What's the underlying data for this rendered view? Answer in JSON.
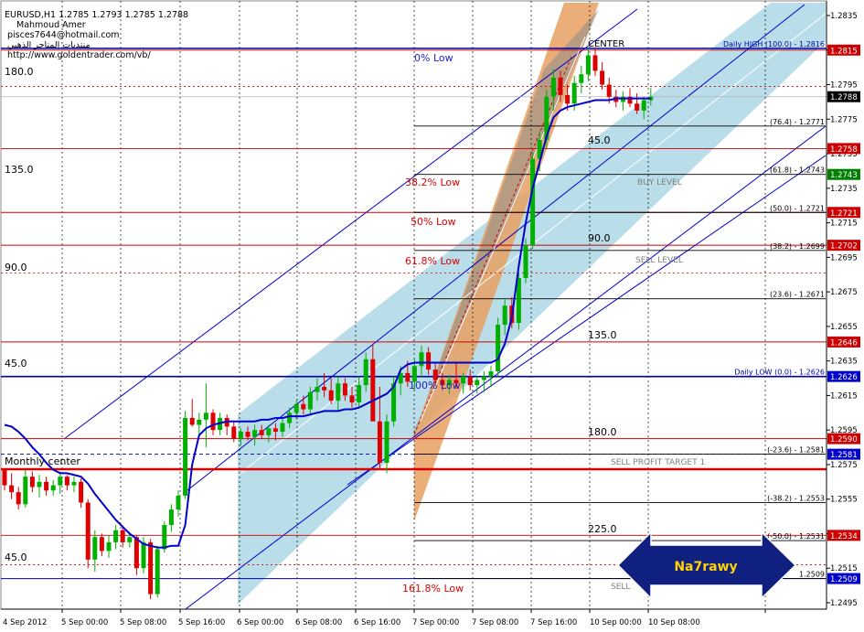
{
  "chart_data": {
    "type": "candlestick",
    "header": {
      "symbol_line": "EURUSD,H1  1.2785 1.2793 1.2785 1.2788",
      "author": "Mahmoud Amer",
      "email": "pisces7644@hotmail.com",
      "arabic": "منتديات المتاجر الذهبي",
      "url": "http://www.goldentrader.com/vb/"
    },
    "x_ticks": [
      "4 Sep 2012",
      "5 Sep 00:00",
      "5 Sep 08:00",
      "5 Sep 16:00",
      "6 Sep 00:00",
      "6 Sep 08:00",
      "6 Sep 16:00",
      "7 Sep 00:00",
      "7 Sep 08:00",
      "7 Sep 16:00",
      "10 Sep 00:00",
      "10 Sep 08:00"
    ],
    "y_ticks": [
      1.2835,
      1.2815,
      1.2795,
      1.2775,
      1.2755,
      1.2735,
      1.2715,
      1.2695,
      1.2675,
      1.2655,
      1.2635,
      1.2615,
      1.2595,
      1.2575,
      1.2555,
      1.2535,
      1.2515,
      1.2495
    ],
    "ylim": [
      1.249,
      1.284
    ],
    "candles": [
      [
        1.2572,
        1.2573,
        1.256,
        1.2563
      ],
      [
        1.2563,
        1.257,
        1.2555,
        1.2559
      ],
      [
        1.2559,
        1.2562,
        1.2549,
        1.2552
      ],
      [
        1.2552,
        1.2572,
        1.255,
        1.2568
      ],
      [
        1.2568,
        1.2571,
        1.2559,
        1.2562
      ],
      [
        1.2562,
        1.2569,
        1.2556,
        1.2565
      ],
      [
        1.2565,
        1.2568,
        1.2557,
        1.256
      ],
      [
        1.256,
        1.2566,
        1.2557,
        1.2563
      ],
      [
        1.2563,
        1.2571,
        1.2558,
        1.2568
      ],
      [
        1.2568,
        1.2569,
        1.256,
        1.2563
      ],
      [
        1.2563,
        1.2568,
        1.2559,
        1.2565
      ],
      [
        1.2565,
        1.2567,
        1.255,
        1.2553
      ],
      [
        1.2553,
        1.2555,
        1.2515,
        1.252
      ],
      [
        1.252,
        1.2537,
        1.2513,
        1.2533
      ],
      [
        1.2533,
        1.2535,
        1.2522,
        1.2525
      ],
      [
        1.2525,
        1.2534,
        1.2521,
        1.253
      ],
      [
        1.253,
        1.254,
        1.2526,
        1.2537
      ],
      [
        1.2537,
        1.2539,
        1.2527,
        1.253
      ],
      [
        1.253,
        1.2536,
        1.2527,
        1.2533
      ],
      [
        1.2533,
        1.2534,
        1.2511,
        1.2515
      ],
      [
        1.2515,
        1.2533,
        1.2512,
        1.253
      ],
      [
        1.253,
        1.2532,
        1.2497,
        1.25
      ],
      [
        1.25,
        1.2528,
        1.2498,
        1.2526
      ],
      [
        1.2526,
        1.2542,
        1.2524,
        1.254
      ],
      [
        1.254,
        1.2552,
        1.2536,
        1.2549
      ],
      [
        1.2549,
        1.256,
        1.2545,
        1.2557
      ],
      [
        1.2557,
        1.2606,
        1.2555,
        1.2602
      ],
      [
        1.2602,
        1.2613,
        1.2597,
        1.2598
      ],
      [
        1.2598,
        1.2605,
        1.2592,
        1.2601
      ],
      [
        1.2601,
        1.2622,
        1.2585,
        1.2605
      ],
      [
        1.2605,
        1.2607,
        1.2592,
        1.2595
      ],
      [
        1.2595,
        1.2605,
        1.2592,
        1.2602
      ],
      [
        1.2602,
        1.2604,
        1.2592,
        1.2597
      ],
      [
        1.2597,
        1.26,
        1.2588,
        1.259
      ],
      [
        1.259,
        1.2596,
        1.2586,
        1.2594
      ],
      [
        1.2594,
        1.2597,
        1.2589,
        1.2591
      ],
      [
        1.2591,
        1.2598,
        1.2586,
        1.2595
      ],
      [
        1.2595,
        1.2598,
        1.259,
        1.2592
      ],
      [
        1.2592,
        1.2598,
        1.2588,
        1.2596
      ],
      [
        1.2596,
        1.2599,
        1.2589,
        1.2594
      ],
      [
        1.2594,
        1.2602,
        1.2591,
        1.2599
      ],
      [
        1.2599,
        1.2608,
        1.2596,
        1.2605
      ],
      [
        1.2605,
        1.2612,
        1.2601,
        1.261
      ],
      [
        1.261,
        1.2615,
        1.2604,
        1.2607
      ],
      [
        1.2607,
        1.262,
        1.2604,
        1.2617
      ],
      [
        1.2617,
        1.2625,
        1.2612,
        1.262
      ],
      [
        1.262,
        1.2628,
        1.2614,
        1.2618
      ],
      [
        1.2618,
        1.2625,
        1.261,
        1.2612
      ],
      [
        1.2612,
        1.2626,
        1.2606,
        1.2622
      ],
      [
        1.2622,
        1.2625,
        1.2612,
        1.2615
      ],
      [
        1.2615,
        1.262,
        1.2608,
        1.2611
      ],
      [
        1.2611,
        1.2626,
        1.2608,
        1.2621
      ],
      [
        1.2621,
        1.264,
        1.2617,
        1.2636
      ],
      [
        1.2636,
        1.2645,
        1.263,
        1.26
      ],
      [
        1.26,
        1.262,
        1.2573,
        1.2576
      ],
      [
        1.2576,
        1.2604,
        1.257,
        1.26
      ],
      [
        1.26,
        1.2626,
        1.2597,
        1.2622
      ],
      [
        1.2622,
        1.2632,
        1.2615,
        1.2628
      ],
      [
        1.2628,
        1.2635,
        1.262,
        1.2623
      ],
      [
        1.2623,
        1.2636,
        1.2618,
        1.2632
      ],
      [
        1.2632,
        1.2644,
        1.2626,
        1.264
      ],
      [
        1.264,
        1.2643,
        1.2627,
        1.263
      ],
      [
        1.263,
        1.2634,
        1.2621,
        1.2624
      ],
      [
        1.2624,
        1.2628,
        1.2618,
        1.2621
      ],
      [
        1.2621,
        1.2627,
        1.2616,
        1.2624
      ],
      [
        1.2624,
        1.2634,
        1.2619,
        1.2622
      ],
      [
        1.2622,
        1.2628,
        1.2616,
        1.2626
      ],
      [
        1.2626,
        1.263,
        1.2618,
        1.2621
      ],
      [
        1.2621,
        1.2626,
        1.2616,
        1.2624
      ],
      [
        1.2624,
        1.2629,
        1.2617,
        1.2626
      ],
      [
        1.2626,
        1.2632,
        1.262,
        1.2629
      ],
      [
        1.2629,
        1.266,
        1.2626,
        1.2656
      ],
      [
        1.2656,
        1.2671,
        1.265,
        1.2667
      ],
      [
        1.2667,
        1.2672,
        1.2654,
        1.2657
      ],
      [
        1.2657,
        1.2686,
        1.2653,
        1.2683
      ],
      [
        1.2683,
        1.2706,
        1.268,
        1.2702
      ],
      [
        1.2702,
        1.2756,
        1.27,
        1.2752
      ],
      [
        1.2752,
        1.2768,
        1.2745,
        1.2763
      ],
      [
        1.2763,
        1.2792,
        1.2758,
        1.2788
      ],
      [
        1.2788,
        1.2804,
        1.278,
        1.2799
      ],
      [
        1.2799,
        1.2803,
        1.2785,
        1.2789
      ],
      [
        1.2789,
        1.2795,
        1.278,
        1.2784
      ],
      [
        1.2784,
        1.28,
        1.278,
        1.2796
      ],
      [
        1.2796,
        1.2806,
        1.279,
        1.2801
      ],
      [
        1.2801,
        1.2816,
        1.2797,
        1.2812
      ],
      [
        1.2812,
        1.2816,
        1.28,
        1.2803
      ],
      [
        1.2803,
        1.2808,
        1.2792,
        1.2795
      ],
      [
        1.2795,
        1.2799,
        1.2784,
        1.2788
      ],
      [
        1.2788,
        1.2792,
        1.2782,
        1.2785
      ],
      [
        1.2785,
        1.2791,
        1.278,
        1.2788
      ],
      [
        1.2788,
        1.2793,
        1.2782,
        1.2784
      ],
      [
        1.2784,
        1.279,
        1.2778,
        1.278
      ],
      [
        1.278,
        1.2788,
        1.2775,
        1.2786
      ],
      [
        1.2786,
        1.2793,
        1.2783,
        1.2788
      ]
    ],
    "ma_line": [
      1.2598,
      1.2597,
      1.2594,
      1.259,
      1.2585,
      1.2581,
      1.2576,
      1.2572,
      1.257,
      1.257,
      1.2569,
      1.2568,
      1.2564,
      1.2558,
      1.2553,
      1.2548,
      1.2543,
      1.2539,
      1.2535,
      1.2532,
      1.2529,
      1.2528,
      1.2527,
      1.2527,
      1.2528,
      1.2528,
      1.254,
      1.2575,
      1.2592,
      1.2596,
      1.2598,
      1.2599,
      1.26,
      1.26,
      1.26,
      1.26,
      1.26,
      1.2601,
      1.2601,
      1.2602,
      1.2602,
      1.2603,
      1.2603,
      1.2603,
      1.2604,
      1.2605,
      1.2606,
      1.2606,
      1.2606,
      1.2607,
      1.2607,
      1.2608,
      1.261,
      1.2612,
      1.2614,
      1.2616,
      1.262,
      1.263,
      1.2633,
      1.2634,
      1.2634,
      1.2634,
      1.2634,
      1.2634,
      1.2634,
      1.2634,
      1.2634,
      1.2634,
      1.2634,
      1.2634,
      1.2634,
      1.2636,
      1.2645,
      1.266,
      1.269,
      1.2715,
      1.2735,
      1.275,
      1.2765,
      1.2776,
      1.278,
      1.2782,
      1.2783,
      1.2784,
      1.2785,
      1.2786,
      1.2786,
      1.2786,
      1.2787,
      1.2787,
      1.2787,
      1.2787,
      1.2787,
      1.2787
    ],
    "fib_lines": [
      {
        "label": "Daily HIGH (100.0) - 1.2816",
        "value": 1.2816,
        "color": "#0000aa"
      },
      {
        "label": "(76.4) - 1.2771",
        "value": 1.2771,
        "color": "#000000"
      },
      {
        "label": "(61.8) - 1.2743",
        "value": 1.2743,
        "color": "#000000"
      },
      {
        "label": "(50.0) - 1.2721",
        "value": 1.2721,
        "color": "#000000"
      },
      {
        "label": "(38.2) - 1.2699",
        "value": 1.2699,
        "color": "#000000"
      },
      {
        "label": "(23.6) - 1.2671",
        "value": 1.2671,
        "color": "#000000"
      },
      {
        "label": "Daily LOW (0.0) - 1.2626",
        "value": 1.2626,
        "color": "#0000aa"
      },
      {
        "label": "(-23.6) - 1.2581",
        "value": 1.2581,
        "color": "#000000"
      },
      {
        "label": "(-38.2) - 1.2553",
        "value": 1.2553,
        "color": "#000000"
      },
      {
        "label": "(-50.0) - 1.2531",
        "value": 1.2531,
        "color": "#000000"
      },
      {
        "label": "1.2509",
        "value": 1.2509,
        "color": "#000000"
      }
    ],
    "red_levels": [
      1.2815,
      1.2758,
      1.2721,
      1.2702,
      1.2646,
      1.259,
      1.2534
    ],
    "price_tags": [
      {
        "text": "1.2815",
        "value": 1.2815,
        "bg": "#cc0000",
        "fg": "#ffffff"
      },
      {
        "text": "1.2788",
        "value": 1.2788,
        "bg": "#000000",
        "fg": "#ffffff"
      },
      {
        "text": "1.2758",
        "value": 1.2758,
        "bg": "#cc0000",
        "fg": "#ffffff"
      },
      {
        "text": "1.2743",
        "value": 1.2743,
        "bg": "#008000",
        "fg": "#ffffff"
      },
      {
        "text": "1.2721",
        "value": 1.2721,
        "bg": "#cc0000",
        "fg": "#ffffff"
      },
      {
        "text": "1.2702",
        "value": 1.2702,
        "bg": "#cc0000",
        "fg": "#ffffff"
      },
      {
        "text": "1.2646",
        "value": 1.2646,
        "bg": "#cc0000",
        "fg": "#ffffff"
      },
      {
        "text": "1.2626",
        "value": 1.2626,
        "bg": "#0000cc",
        "fg": "#ffffff"
      },
      {
        "text": "1.2590",
        "value": 1.259,
        "bg": "#cc0000",
        "fg": "#ffffff"
      },
      {
        "text": "1.2581",
        "value": 1.2581,
        "bg": "#0000cc",
        "fg": "#ffffff"
      },
      {
        "text": "1.2534",
        "value": 1.2534,
        "bg": "#cc0000",
        "fg": "#ffffff"
      },
      {
        "text": "1.2509",
        "value": 1.2509,
        "bg": "#0000cc",
        "fg": "#ffffff"
      }
    ],
    "gann_labels": [
      "180.0",
      "135.0",
      "90.0",
      "45.0",
      "45.0",
      "90.0",
      "135.0",
      "180.0",
      "225.0"
    ],
    "left_labels": [
      "180.0",
      "135.0",
      "90.0",
      "45.0",
      "45.0"
    ],
    "fib_pct_labels": [
      "0% Low",
      "38.2% Low",
      "50% Low",
      "61.8% Low",
      "100% Low",
      "161.8% Low"
    ],
    "text_labels": {
      "center": "CENTER",
      "monthly_center": "Monthly center",
      "buy_level": "BUY LEVEL",
      "sell_level": "SELL LEVEL",
      "sell_profit_target": "SELL PROFIT TARGET 1",
      "sell_partial": "SELL"
    },
    "arrow_label": "Na7rawy",
    "colors": {
      "bull": "#00b000",
      "bear": "#dd0000",
      "ma": "#0000cc",
      "channel_fill": "#add8e6",
      "orange_band": "#e8a060",
      "gray_band": "#a0a0a0",
      "arrow_fill": "#102080",
      "arrow_text": "#ffd400"
    }
  }
}
